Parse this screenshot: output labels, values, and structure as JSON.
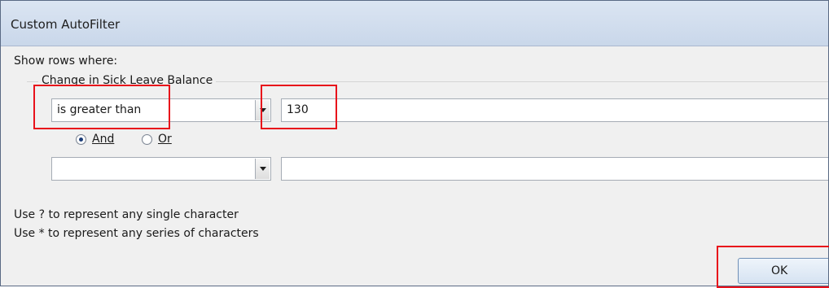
{
  "dialog": {
    "title": "Custom AutoFilter",
    "show_rows_label": "Show rows where:",
    "field_label": "Change in Sick Leave Balance"
  },
  "criteria1": {
    "operator": "is greater than",
    "value": "130"
  },
  "logic": {
    "and_label": "And",
    "or_label": "Or",
    "selected": "And"
  },
  "criteria2": {
    "operator": "",
    "value": ""
  },
  "hints": {
    "line1": "Use ? to represent any single character",
    "line2": "Use * to represent any series of characters"
  },
  "buttons": {
    "ok_label": "OK"
  },
  "highlight_color": "#e8121b"
}
